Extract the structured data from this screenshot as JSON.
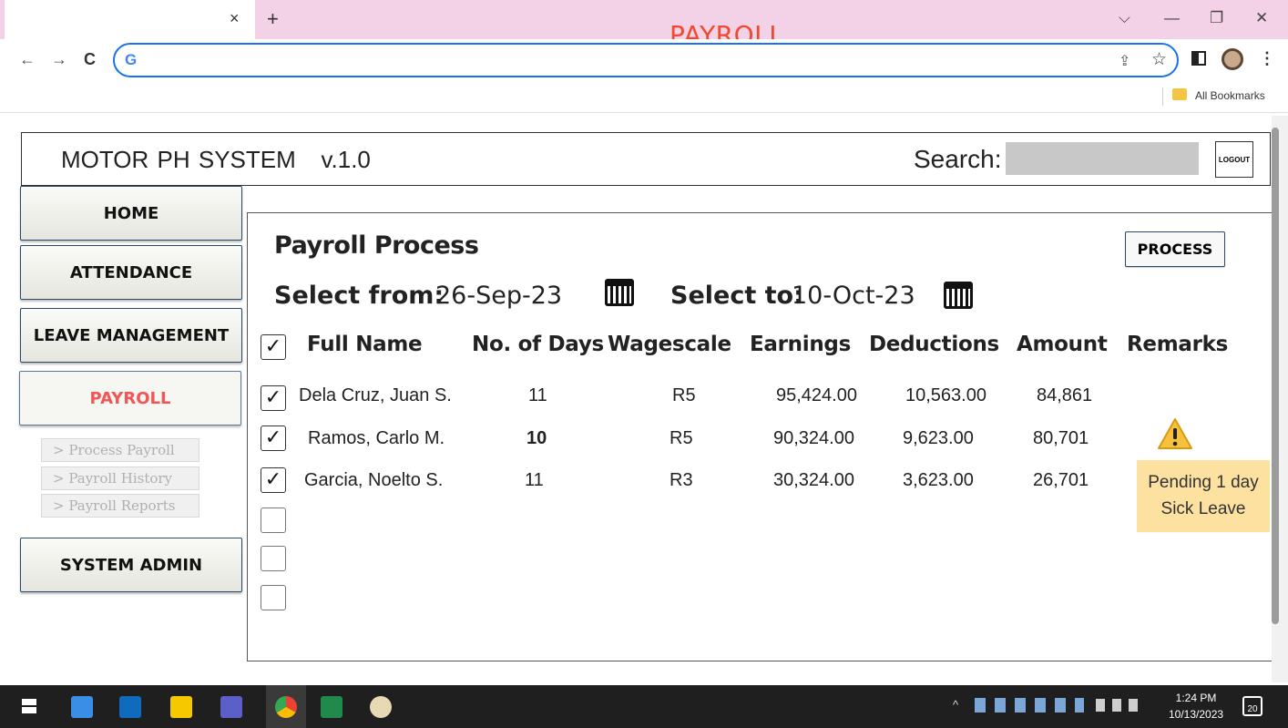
{
  "browser": {
    "window_title": "PAYROLL",
    "tab_close": "×",
    "new_tab": "+",
    "back": "←",
    "forward": "→",
    "reload": "C",
    "google_mark": "G",
    "share_icon": "⇪",
    "star_icon": "☆",
    "menu_icon": "⋮",
    "minimize": "—",
    "restore": "❐",
    "close": "✕",
    "dropdown": "⌵",
    "bookmarks_label": "All Bookmarks"
  },
  "app": {
    "title": "MOTOR PH SYSTEM   v.1.0",
    "search_label": "Search:",
    "logout_label": "LOGOUT"
  },
  "nav": {
    "home": "HOME",
    "attendance": "ATTENDANCE",
    "leave": "LEAVE MANAGEMENT",
    "payroll": "PAYROLL",
    "system_admin": "SYSTEM ADMIN",
    "sub": [
      ">  Process Payroll",
      ">  Payroll History",
      ">  Payroll Reports"
    ]
  },
  "panel": {
    "title": "Payroll Process",
    "process_button": "PROCESS",
    "from_label": "Select from:",
    "from_value": "26-Sep-23",
    "to_label": "Select to:",
    "to_value": "10-Oct-23",
    "headers": [
      "Full Name",
      "No. of Days",
      "Wagescale",
      "Earnings",
      "Deductions",
      "Amount",
      "Remarks"
    ],
    "rows": [
      {
        "name": "Dela Cruz, Juan S.",
        "days": "11",
        "wage": "R5",
        "earnings": "95,424.00",
        "deductions": "10,563.00",
        "amount": "84,861"
      },
      {
        "name": "Ramos, Carlo M.",
        "days": "10",
        "wage": "R5",
        "earnings": "90,324.00",
        "deductions": "9,623.00",
        "amount": "80,701"
      },
      {
        "name": "Garcia, Noelto S.",
        "days": "11",
        "wage": "R3",
        "earnings": "30,324.00",
        "deductions": "3,623.00",
        "amount": "26,701"
      }
    ],
    "remark_line1": "Pending 1 day",
    "remark_line2": "Sick Leave",
    "check": "✓"
  },
  "taskbar": {
    "time": "1:24 PM",
    "date": "10/13/2023",
    "notifications": "20"
  },
  "colors": {
    "tabbar": "#f3d1e6",
    "window_title": "#f04a2e",
    "payroll_active": "#f25555",
    "remark_bg": "#fde1a0",
    "omnibox_border": "#1a73e8"
  }
}
